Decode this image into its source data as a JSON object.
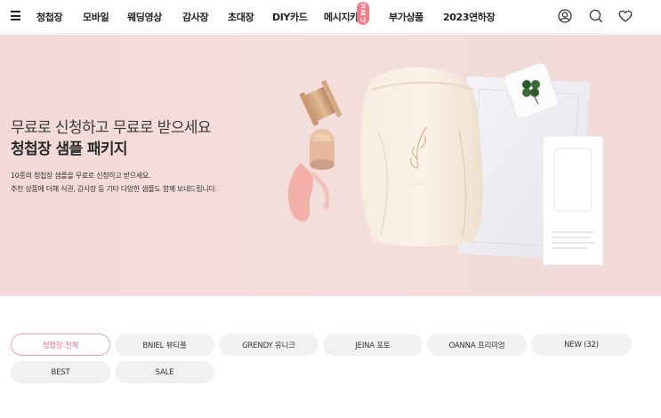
{
  "header": {
    "nav": [
      {
        "label": "청첩장"
      },
      {
        "label": "모바일"
      },
      {
        "label": "웨딩영상"
      },
      {
        "label": "감사장"
      },
      {
        "label": "초대장"
      },
      {
        "label": "DIY카드"
      },
      {
        "label": "메시지카드"
      },
      {
        "label": "부가상품"
      },
      {
        "label": "2023연하장"
      }
    ],
    "badge": "코로나",
    "icons": [
      "menu-icon",
      "account-icon",
      "search-icon",
      "heart-icon"
    ]
  },
  "hero": {
    "title": "무료로 신청하고 무료로 받으세요",
    "subtitle": "청첩장 샘플 패키지",
    "desc_line1": "10종의 청첩장 샘플을 무료로 신청하고 받으세요.",
    "desc_line2": "추천 상품에 더해 식권, 감사장 등 기타 다양한 샘플도 함께 보내드립니다."
  },
  "categories": [
    {
      "label": "청첩장 전체",
      "active": true
    },
    {
      "label": "BNIEL 뷰티풀"
    },
    {
      "label": "GRENDY 유니크"
    },
    {
      "label": "JEINA 포토"
    },
    {
      "label": "OANNA 프리미엄"
    },
    {
      "label": "NEW (32)"
    },
    {
      "label": "BEST"
    },
    {
      "label": "SALE"
    }
  ],
  "colors": {
    "hero_bg": "#f3dcda",
    "accent_pink": "#e8707f",
    "chip_bg": "#f1f1f1"
  }
}
